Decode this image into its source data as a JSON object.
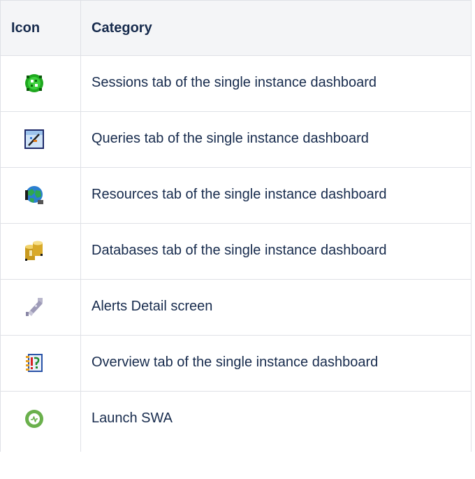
{
  "table": {
    "headers": {
      "icon": "Icon",
      "category": "Category"
    },
    "rows": [
      {
        "icon": "sessions-icon",
        "category": "Sessions tab of the single instance dashboard"
      },
      {
        "icon": "queries-icon",
        "category": "Queries tab of the single instance dashboard"
      },
      {
        "icon": "resources-icon",
        "category": "Resources tab of the single instance dashboard"
      },
      {
        "icon": "databases-icon",
        "category": "Databases tab of the single instance dashboard"
      },
      {
        "icon": "alerts-detail-icon",
        "category": "Alerts Detail screen"
      },
      {
        "icon": "overview-icon",
        "category": "Overview tab of the single instance dashboard"
      },
      {
        "icon": "launch-swa-icon",
        "category": "Launch SWA"
      }
    ]
  },
  "colors": {
    "header_bg": "#f4f5f7",
    "border": "#dfe1e6",
    "text": "#172b4d"
  }
}
